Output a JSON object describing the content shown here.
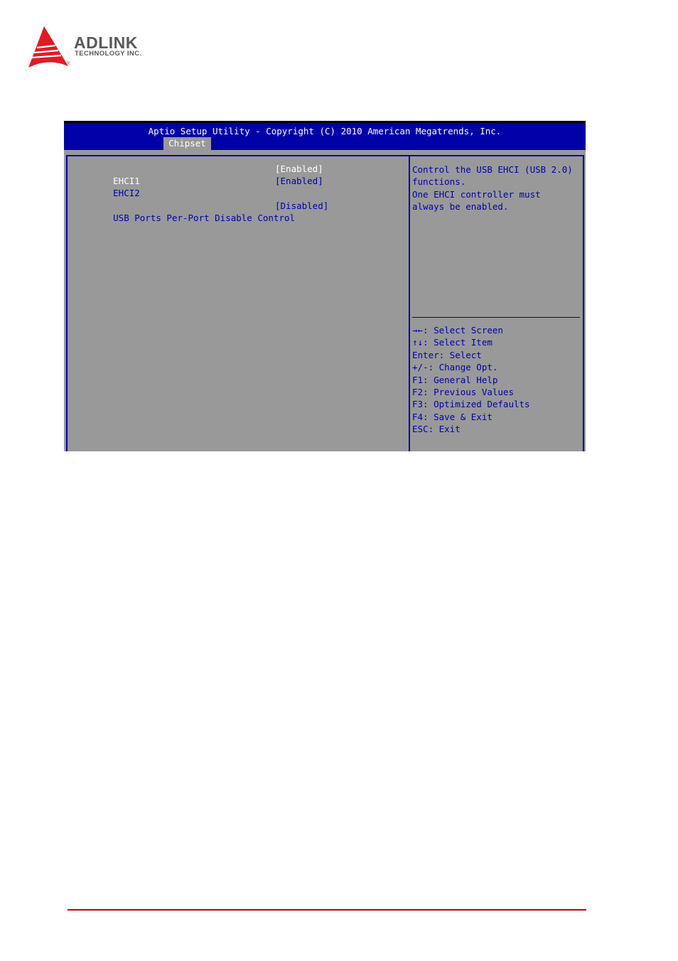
{
  "brand": {
    "name": "ADLINK",
    "subtitle": "TECHNOLOGY INC.",
    "registered": "®",
    "colors": {
      "logo_red": "#e31b23",
      "logo_gray": "#58595b"
    }
  },
  "bios": {
    "title": "Aptio Setup Utility - Copyright (C) 2010 American Megatrends, Inc.",
    "active_tab": "Chipset",
    "colors": {
      "header_bg": "#0000a8",
      "panel_bg": "#999999",
      "text": "#0000a8",
      "selected_text": "#ffffff"
    },
    "settings": [
      {
        "label": "EHCI1",
        "value": "[Enabled]",
        "selected": true
      },
      {
        "label": "EHCI2",
        "value": "[Enabled]",
        "selected": false
      },
      {
        "label": "USB Ports Per-Port Disable Control",
        "value": "[Disabled]",
        "selected": false
      }
    ],
    "help_text": [
      "Control the USB EHCI (USB 2.0)",
      "functions.",
      "One EHCI controller must",
      "always be enabled."
    ],
    "key_help": [
      {
        "icon": "left-right-arrows-icon",
        "text": "→←: Select Screen"
      },
      {
        "icon": "up-down-arrows-icon",
        "text": "↑↓: Select Item"
      },
      {
        "text": "Enter: Select"
      },
      {
        "text": "+/-: Change Opt."
      },
      {
        "text": "F1: General Help"
      },
      {
        "text": "F2: Previous Values"
      },
      {
        "text": "F3: Optimized Defaults"
      },
      {
        "text": "F4: Save & Exit"
      },
      {
        "text": "ESC: Exit"
      }
    ]
  }
}
